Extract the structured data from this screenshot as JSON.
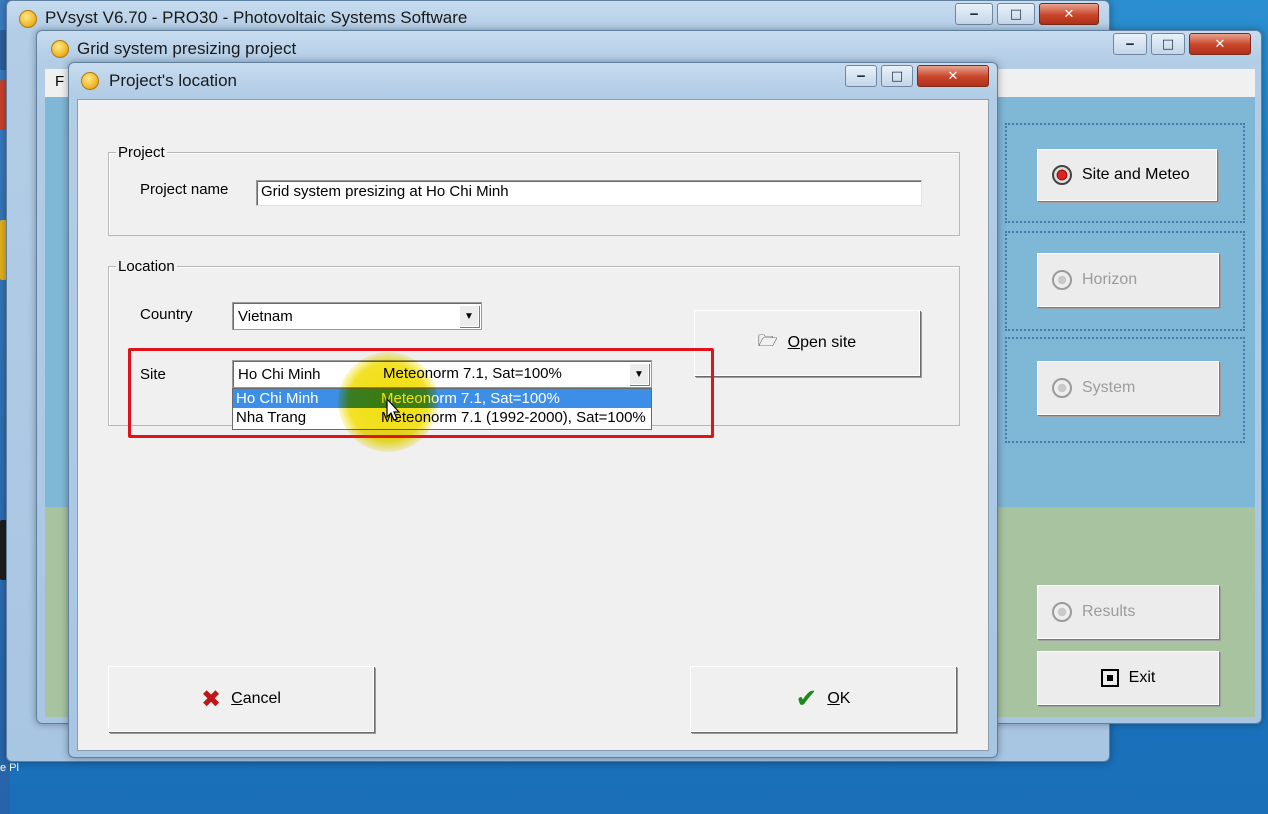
{
  "main_window": {
    "title": "PVsyst V6.70 - PRO30 - Photovoltaic Systems Software",
    "minimize": "‒",
    "maximize": "□",
    "close": "✕"
  },
  "project_window": {
    "title": "Grid system presizing project",
    "menu_letter": "F",
    "minimize": "‒",
    "maximize": "□",
    "close": "✕",
    "buttons": {
      "site_and_meteo": "Site and Meteo",
      "horizon": "Horizon",
      "system": "System",
      "results": "Results",
      "exit": "Exit"
    }
  },
  "dialog": {
    "title": "Project's location",
    "minimize": "‒",
    "maximize": "□",
    "close": "✕",
    "project_group": {
      "title": "Project",
      "name_label": "Project name",
      "name_value": "Grid system presizing  at  Ho Chi Minh"
    },
    "location_group": {
      "title": "Location",
      "country_label": "Country",
      "country_value": "Vietnam",
      "site_label": "Site",
      "site_value": "Ho Chi Minh",
      "site_meteo": "Meteonorm 7.1, Sat=100%",
      "open_site": "Open site",
      "options": [
        {
          "site": "Ho Chi Minh",
          "meteo": "Meteonorm 7.1, Sat=100%",
          "selected": true
        },
        {
          "site": "Nha Trang",
          "meteo": "Meteonorm 7.1 (1992-2000), Sat=100%",
          "selected": false
        }
      ]
    },
    "cancel": "Cancel",
    "ok": "OK"
  },
  "desktop": {
    "bottom_text": "e Pl"
  },
  "colors": {
    "highlight_red": "#e0121a",
    "selection_blue": "#3d8ee6",
    "cursor_yellow": "#f0dc00"
  }
}
